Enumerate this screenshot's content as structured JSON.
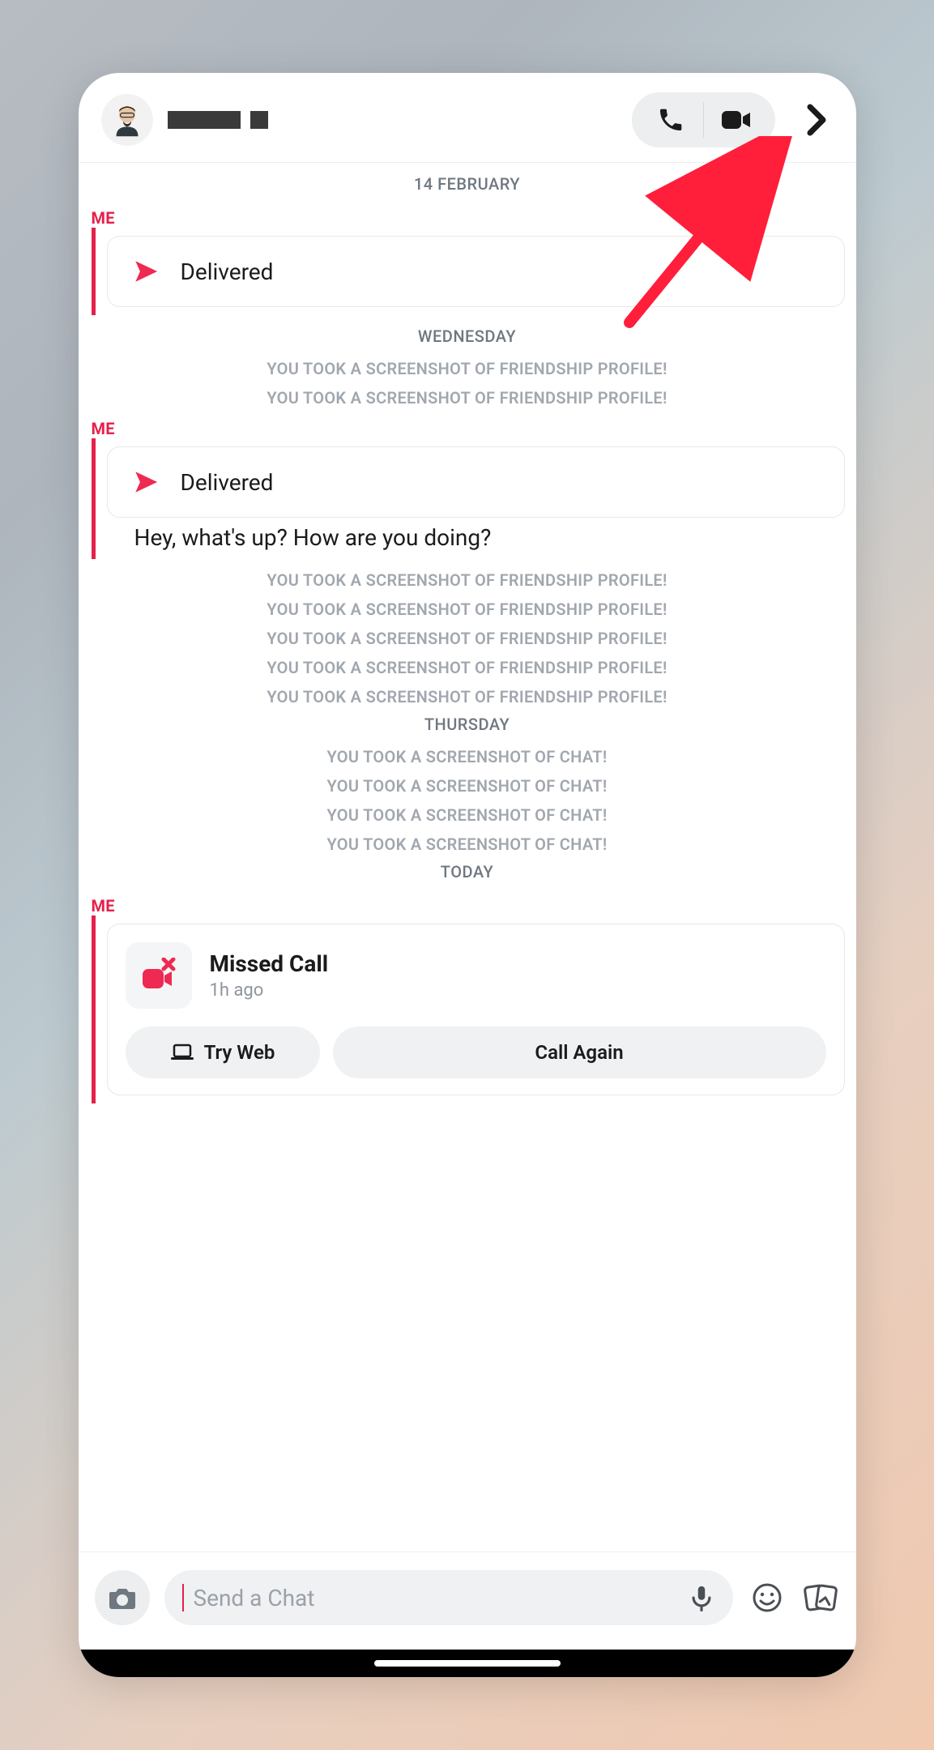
{
  "header": {
    "name_redacted": true
  },
  "timeline": {
    "date1": "14 FEBRUARY",
    "me": "ME",
    "delivered": "Delivered",
    "day2": "WEDNESDAY",
    "sys_friend": "YOU TOOK A SCREENSHOT OF FRIENDSHIP PROFILE!",
    "msg1": "Hey, what's up? How are you doing?",
    "day3": "THURSDAY",
    "sys_chat": "YOU TOOK A SCREENSHOT OF CHAT!",
    "day4": "TODAY"
  },
  "missed": {
    "title": "Missed Call",
    "sub": "1h ago",
    "tryweb": "Try Web",
    "callagain": "Call Again"
  },
  "composer": {
    "placeholder": "Send a Chat"
  }
}
